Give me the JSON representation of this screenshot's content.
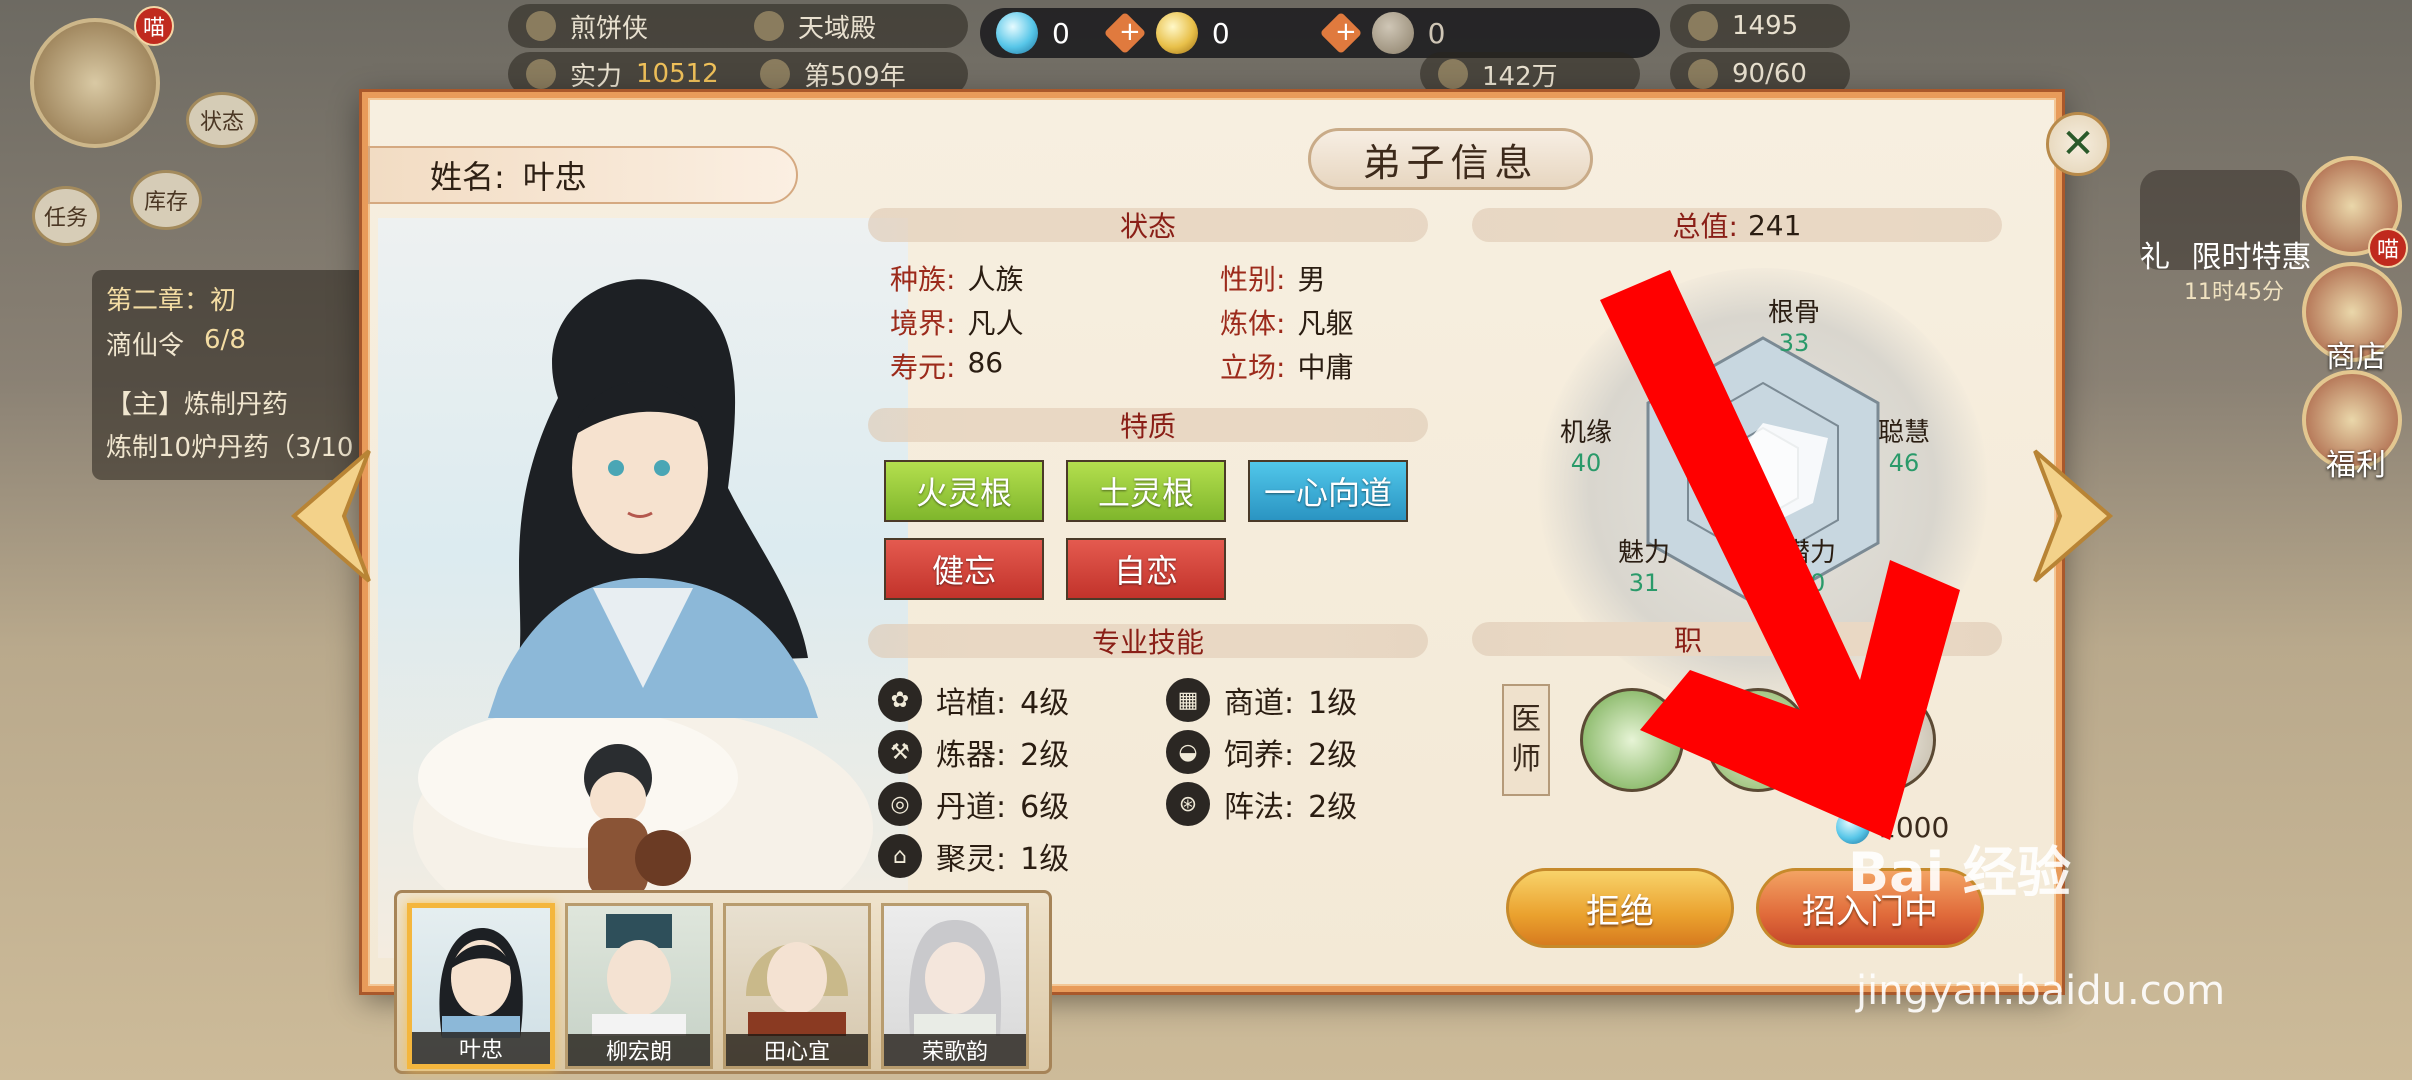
{
  "hud": {
    "left_bar_1": "煎饼侠",
    "left_bar_2": "天域殿",
    "left_bar_3_label": "实力",
    "left_bar_3_value": "10512",
    "left_bar_4": "第509年",
    "gem_blue": "0",
    "gem_gold": "0",
    "gem_grey": "0",
    "right_1": "1495",
    "right_2": "142万",
    "right_3": "90/60"
  },
  "side": {
    "badge": "喵",
    "status_btn": "状态",
    "task_btn": "任务",
    "storage_btn": "库存",
    "chapter": "第二章：初",
    "token": "滴仙令",
    "progress": "6/8",
    "quest_title": "【主】炼制丹药",
    "quest_desc": "炼制10炉丹药（3/10",
    "right_gift": "礼",
    "right_sale": "限时特惠",
    "right_timer": "11时45分",
    "right_shop": "商店",
    "right_welfare": "福利",
    "right_badge": "喵"
  },
  "dialog": {
    "title": "弟子信息",
    "name_label": "姓名:",
    "name_value": "叶忠",
    "status_header": "状态",
    "stats": {
      "race_k": "种族:",
      "race_v": "人族",
      "gender_k": "性别:",
      "gender_v": "男",
      "realm_k": "境界:",
      "realm_v": "凡人",
      "body_k": "炼体:",
      "body_v": "凡躯",
      "life_k": "寿元:",
      "life_v": "86",
      "stance_k": "立场:",
      "stance_v": "中庸"
    },
    "traits_header": "特质",
    "traits": [
      "火灵根",
      "土灵根",
      "一心向道",
      "健忘",
      "自恋"
    ],
    "skills_header": "专业技能",
    "skills": [
      {
        "name": "培植:",
        "level": "4级"
      },
      {
        "name": "商道:",
        "level": "1级"
      },
      {
        "name": "炼器:",
        "level": "2级"
      },
      {
        "name": "饲养:",
        "level": "2级"
      },
      {
        "name": "丹道:",
        "level": "6级"
      },
      {
        "name": "阵法:",
        "level": "2级"
      },
      {
        "name": "聚灵:",
        "level": "1级"
      }
    ],
    "total_label": "总值:",
    "total_value": "241",
    "attributes": {
      "bone_k": "根骨",
      "bone_v": "33",
      "wisdom_k": "聪慧",
      "wisdom_v": "46",
      "potential_k": "潜力",
      "potential_v": "40",
      "charm_k": "魅力",
      "charm_v": "31",
      "luck_k": "机缘",
      "luck_v": "40"
    },
    "career_header": "职",
    "career_header_tail": "务",
    "vertical_badge": [
      "医",
      "师"
    ],
    "cost": "1000",
    "reject_btn": "拒绝",
    "recruit_btn": "招入门中"
  },
  "roster": [
    "叶忠",
    "柳宏朗",
    "田心宜",
    "荣歌韵"
  ],
  "watermark_line1": "Bai 经验",
  "watermark_line2": "jingyan.baidu.com"
}
